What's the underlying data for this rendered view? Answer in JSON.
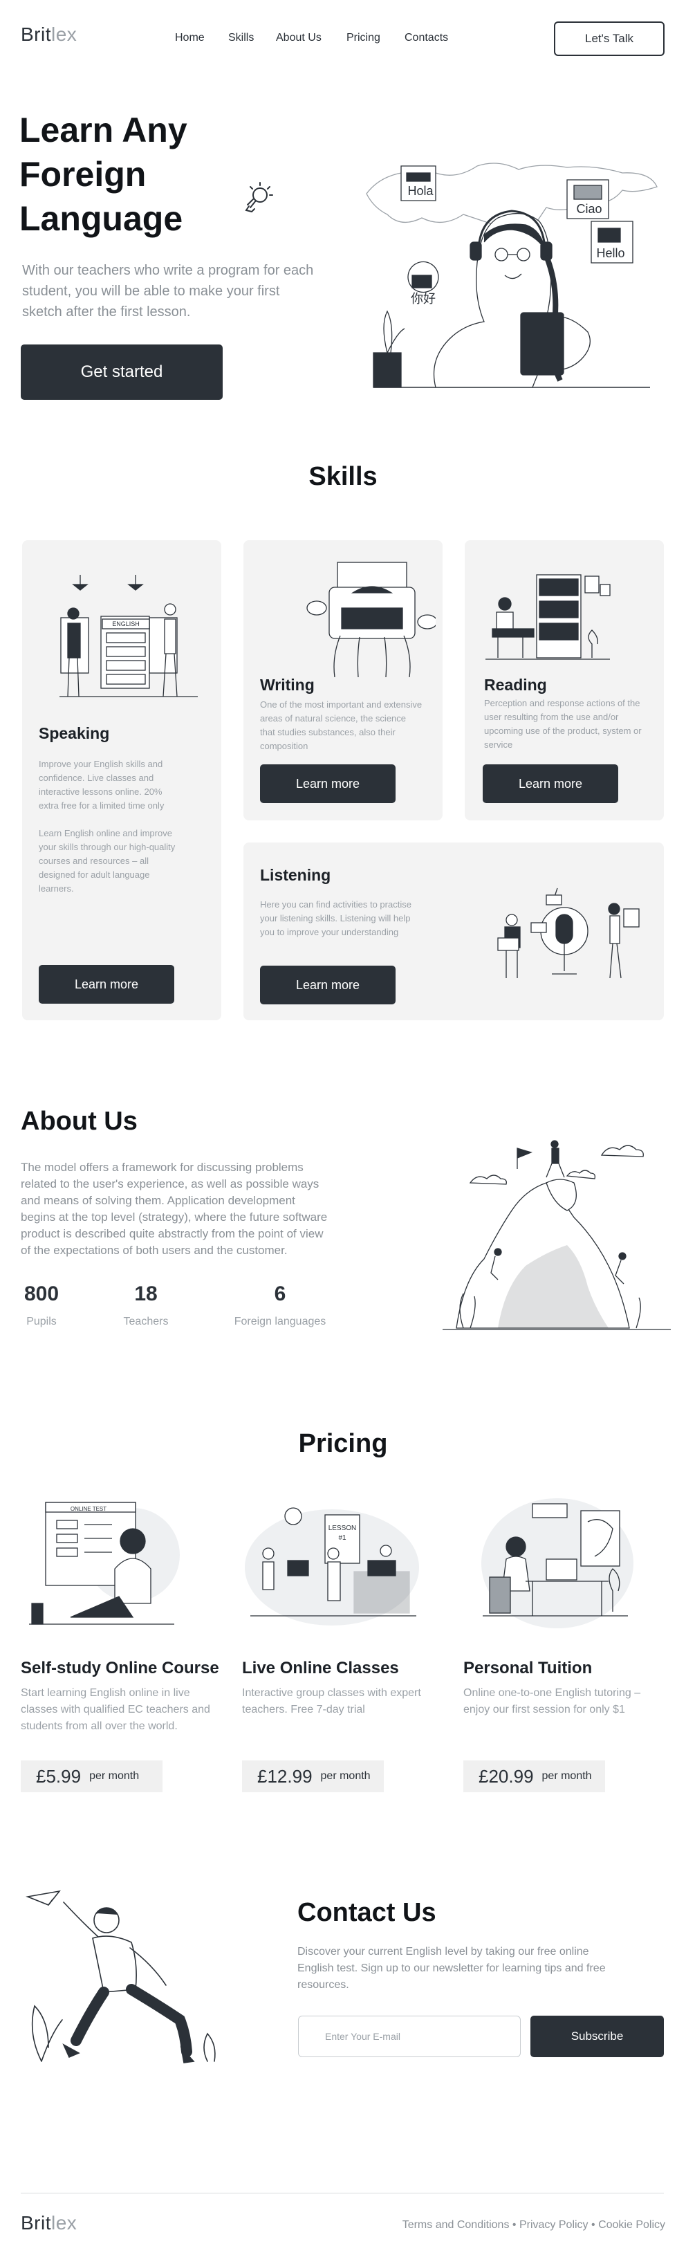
{
  "brand": {
    "part1": "Brit",
    "part2": "lex"
  },
  "nav": {
    "items": [
      "Home",
      "Skills",
      "About Us",
      "Pricing",
      "Contacts"
    ],
    "cta": "Let's Talk"
  },
  "hero": {
    "title_line1": "Learn Any",
    "title_line2": "Foreign",
    "title_line3": "Language",
    "subtitle": "With our teachers who write a program for each student, you will be able to make your first sketch after the first lesson.",
    "button": "Get started",
    "bubbles": [
      "Hola",
      "Ciao",
      "你好",
      "Hello"
    ]
  },
  "skills": {
    "title": "Skills",
    "cards": [
      {
        "title": "Speaking",
        "text1": "Improve your English skills and confidence. Live classes and interactive lessons online. 20% extra free for a limited time only",
        "text2": "Learn English online and improve your skills through our high-quality courses and resources – all designed for adult language learners.",
        "button": "Learn more",
        "board_label": "ENGLISH"
      },
      {
        "title": "Writing",
        "text1": "One of the most important and extensive areas of natural science, the science that studies substances, also their composition",
        "button": "Learn more"
      },
      {
        "title": "Reading",
        "text1": "Perception and response actions of the user resulting from the use and/or upcoming use of the product, system or service",
        "button": "Learn more"
      },
      {
        "title": "Listening",
        "text1": "Here you can find activities to practise your listening skills. Listening will help you to improve your understanding",
        "button": "Learn more"
      }
    ]
  },
  "about": {
    "title": "About Us",
    "text": "The model offers a framework for discussing problems related to the user's experience, as well as possible ways and means of solving them. Application development begins at the top level (strategy), where the future software product is described quite abstractly from the point of view of the expectations of both users and the customer.",
    "stats": [
      {
        "value": "800",
        "label": "Pupils"
      },
      {
        "value": "18",
        "label": "Teachers"
      },
      {
        "value": "6",
        "label": "Foreign languages"
      }
    ]
  },
  "pricing": {
    "title": "Pricing",
    "plans": [
      {
        "title": "Self-study Online Course",
        "text": "Start learning English online in live classes with qualified EC teachers and students from all over the world.",
        "price": "£5.99",
        "period": "per month",
        "screen_label": "ONLINE TEST"
      },
      {
        "title": "Live Online Classes",
        "text": "Interactive group classes with expert teachers. Free 7-day trial",
        "price": "£12.99",
        "period": "per month",
        "board_label1": "LESSON",
        "board_label2": "#1"
      },
      {
        "title": "Personal Tuition",
        "text": "Online one-to-one English tutoring – enjoy our first session for only $1",
        "price": "£20.99",
        "period": "per month"
      }
    ]
  },
  "contact": {
    "title": "Contact Us",
    "text": "Discover your current English level by taking our free online English test. Sign up to our newsletter for learning tips and free resources.",
    "email_placeholder": "Enter Your E-mail",
    "button": "Subscribe"
  },
  "footer": {
    "links": [
      "Terms and Conditions",
      "Privacy Policy",
      "Cookie Policy"
    ],
    "separator": "•"
  },
  "colors": {
    "dark": "#2b3138",
    "muted": "#9ba1a7",
    "card_bg": "#f3f3f3"
  }
}
